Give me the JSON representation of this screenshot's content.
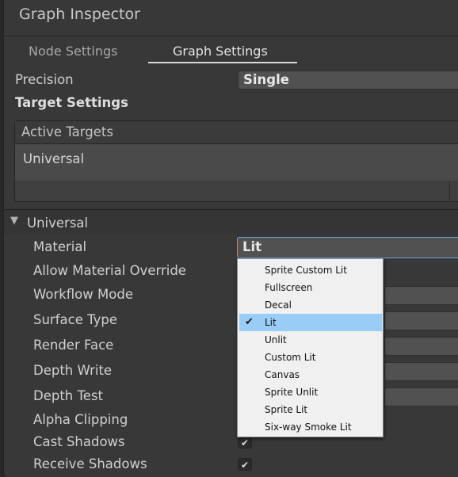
{
  "window": {
    "title": "Graph Inspector"
  },
  "tabs": [
    {
      "label": "Node Settings",
      "active": false
    },
    {
      "label": "Graph Settings",
      "active": true
    }
  ],
  "precision": {
    "label": "Precision",
    "value": "Single"
  },
  "target_settings": {
    "heading": "Target Settings",
    "active_targets_header": "Active Targets",
    "targets": [
      "Universal"
    ]
  },
  "universal": {
    "section_label": "Universal",
    "expanded": true,
    "properties": [
      {
        "label": "Material",
        "value": "Lit",
        "control": "dropdown"
      },
      {
        "label": "Allow Material Override",
        "control": "checkbox"
      },
      {
        "label": "Workflow Mode",
        "control": "dropdown"
      },
      {
        "label": "Surface Type",
        "control": "dropdown"
      },
      {
        "label": "Render Face",
        "control": "dropdown"
      },
      {
        "label": "Depth Write",
        "control": "dropdown"
      },
      {
        "label": "Depth Test",
        "control": "dropdown"
      },
      {
        "label": "Alpha Clipping",
        "control": "checkbox"
      },
      {
        "label": "Cast Shadows",
        "control": "checkbox",
        "checked": true
      },
      {
        "label": "Receive Shadows",
        "control": "checkbox",
        "checked": true
      }
    ]
  },
  "material_dropdown": {
    "open": true,
    "selected": "Lit",
    "options": [
      "Sprite Custom Lit",
      "Fullscreen",
      "Decal",
      "Lit",
      "Unlit",
      "Custom Lit",
      "Canvas",
      "Sprite Unlit",
      "Sprite Lit",
      "Six-way Smoke Lit"
    ]
  },
  "check_glyph": "✔",
  "colors": {
    "panel_bg": "#383838",
    "selection_highlight": "#99cdf6",
    "focus_border": "#6aa1d8"
  }
}
